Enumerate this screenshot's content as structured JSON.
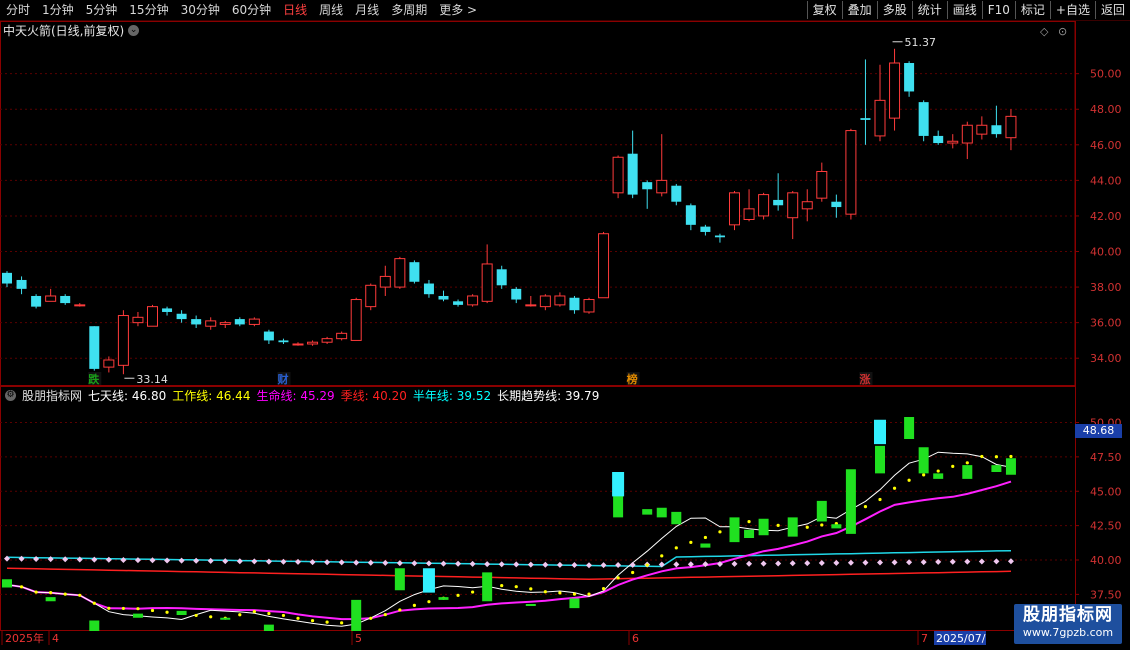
{
  "toolbar": {
    "periods": [
      "分时",
      "1分钟",
      "5分钟",
      "15分钟",
      "30分钟",
      "60分钟",
      "日线",
      "周线",
      "月线",
      "多周期",
      "更多 >"
    ],
    "active_period": "日线",
    "right_buttons": [
      "复权",
      "叠加",
      "多股",
      "统计",
      "画线",
      "F10",
      "标记",
      "+自选",
      "返回"
    ]
  },
  "main_chart": {
    "title": "中天火箭(日线,前复权)",
    "y_ticks": [
      "50.00",
      "48.00",
      "46.00",
      "44.00",
      "42.00",
      "40.00",
      "38.00",
      "36.00",
      "34.00"
    ],
    "high_label": "51.37",
    "low_label": "33.14",
    "event_tags": [
      {
        "text": "跌",
        "color": "#1aa01a"
      },
      {
        "text": "财",
        "color": "#2a60d0"
      },
      {
        "text": "榜",
        "color": "#e08a00"
      },
      {
        "text": "涨",
        "color": "#c83030"
      }
    ]
  },
  "indicator": {
    "name": "股朋指标网",
    "lines": [
      {
        "label": "七天线:",
        "value": "46.80",
        "color": "#ffffff"
      },
      {
        "label": "工作线:",
        "value": "46.44",
        "color": "#ffff00"
      },
      {
        "label": "生命线:",
        "value": "45.29",
        "color": "#ff00ff"
      },
      {
        "label": "季线:",
        "value": "40.20",
        "color": "#ff2020"
      },
      {
        "label": "半年线:",
        "value": "39.52",
        "color": "#00ffff"
      },
      {
        "label": "长期趋势线:",
        "value": "39.79",
        "color": "#ffffff"
      }
    ],
    "y_ticks": [
      "50.00",
      "47.50",
      "45.00",
      "42.50",
      "40.00",
      "37.50"
    ],
    "current_price": "48.68"
  },
  "date_axis": {
    "labels": [
      "2025年",
      "4",
      "5",
      "6",
      "7",
      "2025/07/"
    ]
  },
  "watermark": {
    "line1": "股朋指标网",
    "line2": "www.7gpzb.com"
  },
  "chart_data": {
    "type": "candlestick",
    "title": "中天火箭(日线,前复权)",
    "ylim": [
      33,
      51.5
    ],
    "candles": [
      {
        "o": 38.8,
        "c": 38.2,
        "h": 38.9,
        "l": 38.0
      },
      {
        "o": 38.4,
        "c": 37.9,
        "h": 38.6,
        "l": 37.6
      },
      {
        "o": 37.5,
        "c": 36.9,
        "h": 37.6,
        "l": 36.8
      },
      {
        "o": 37.2,
        "c": 37.5,
        "h": 37.9,
        "l": 37.2
      },
      {
        "o": 37.5,
        "c": 37.1,
        "h": 37.6,
        "l": 37.0
      },
      {
        "o": 37.0,
        "c": 37.0,
        "h": 37.1,
        "l": 36.9
      },
      {
        "o": 35.8,
        "c": 33.4,
        "h": 35.8,
        "l": 33.3
      },
      {
        "o": 33.5,
        "c": 33.9,
        "h": 34.1,
        "l": 33.2
      },
      {
        "o": 33.6,
        "c": 36.4,
        "h": 36.7,
        "l": 33.1
      },
      {
        "o": 36.0,
        "c": 36.3,
        "h": 36.6,
        "l": 35.8
      },
      {
        "o": 35.8,
        "c": 36.9,
        "h": 37.0,
        "l": 35.8
      },
      {
        "o": 36.8,
        "c": 36.6,
        "h": 36.9,
        "l": 36.4
      },
      {
        "o": 36.5,
        "c": 36.2,
        "h": 36.7,
        "l": 36.0
      },
      {
        "o": 36.2,
        "c": 35.9,
        "h": 36.4,
        "l": 35.7
      },
      {
        "o": 35.8,
        "c": 36.1,
        "h": 36.3,
        "l": 35.6
      },
      {
        "o": 35.9,
        "c": 36.0,
        "h": 36.1,
        "l": 35.7
      },
      {
        "o": 36.2,
        "c": 35.9,
        "h": 36.3,
        "l": 35.8
      },
      {
        "o": 35.9,
        "c": 36.2,
        "h": 36.3,
        "l": 35.8
      },
      {
        "o": 35.5,
        "c": 35.0,
        "h": 35.6,
        "l": 34.8
      },
      {
        "o": 35.0,
        "c": 34.9,
        "h": 35.1,
        "l": 34.8
      },
      {
        "o": 34.8,
        "c": 34.8,
        "h": 34.9,
        "l": 34.7
      },
      {
        "o": 34.8,
        "c": 34.9,
        "h": 35.0,
        "l": 34.7
      },
      {
        "o": 34.9,
        "c": 35.1,
        "h": 35.2,
        "l": 34.8
      },
      {
        "o": 35.1,
        "c": 35.4,
        "h": 35.5,
        "l": 35.0
      },
      {
        "o": 35.0,
        "c": 37.3,
        "h": 37.4,
        "l": 35.0
      },
      {
        "o": 36.9,
        "c": 38.1,
        "h": 38.2,
        "l": 36.7
      },
      {
        "o": 38.0,
        "c": 38.6,
        "h": 39.2,
        "l": 37.5
      },
      {
        "o": 38.0,
        "c": 39.6,
        "h": 39.7,
        "l": 37.9
      },
      {
        "o": 39.4,
        "c": 38.3,
        "h": 39.5,
        "l": 38.2
      },
      {
        "o": 38.2,
        "c": 37.6,
        "h": 38.4,
        "l": 37.4
      },
      {
        "o": 37.5,
        "c": 37.3,
        "h": 37.8,
        "l": 37.2
      },
      {
        "o": 37.2,
        "c": 37.0,
        "h": 37.3,
        "l": 36.9
      },
      {
        "o": 37.0,
        "c": 37.5,
        "h": 37.6,
        "l": 36.9
      },
      {
        "o": 37.2,
        "c": 39.3,
        "h": 40.4,
        "l": 37.1
      },
      {
        "o": 39.0,
        "c": 38.1,
        "h": 39.2,
        "l": 37.9
      },
      {
        "o": 37.9,
        "c": 37.3,
        "h": 38.0,
        "l": 37.1
      },
      {
        "o": 37.0,
        "c": 37.0,
        "h": 37.5,
        "l": 36.9
      },
      {
        "o": 36.9,
        "c": 37.5,
        "h": 37.6,
        "l": 36.7
      },
      {
        "o": 37.0,
        "c": 37.5,
        "h": 37.7,
        "l": 36.9
      },
      {
        "o": 37.4,
        "c": 36.7,
        "h": 37.5,
        "l": 36.5
      },
      {
        "o": 36.6,
        "c": 37.3,
        "h": 37.4,
        "l": 36.5
      },
      {
        "o": 37.4,
        "c": 41.0,
        "h": 41.1,
        "l": 37.4
      },
      {
        "o": 43.3,
        "c": 45.3,
        "h": 45.4,
        "l": 43.0
      },
      {
        "o": 45.5,
        "c": 43.2,
        "h": 46.8,
        "l": 43.0
      },
      {
        "o": 43.9,
        "c": 43.5,
        "h": 44.0,
        "l": 42.4
      },
      {
        "o": 43.3,
        "c": 44.0,
        "h": 46.6,
        "l": 43.1
      },
      {
        "o": 43.7,
        "c": 42.8,
        "h": 43.8,
        "l": 42.6
      },
      {
        "o": 42.6,
        "c": 41.5,
        "h": 42.7,
        "l": 41.2
      },
      {
        "o": 41.4,
        "c": 41.1,
        "h": 41.5,
        "l": 40.9
      },
      {
        "o": 40.9,
        "c": 40.8,
        "h": 41.0,
        "l": 40.5
      },
      {
        "o": 41.5,
        "c": 43.3,
        "h": 43.4,
        "l": 41.2
      },
      {
        "o": 41.8,
        "c": 42.4,
        "h": 43.5,
        "l": 41.7
      },
      {
        "o": 42.0,
        "c": 43.2,
        "h": 43.3,
        "l": 41.8
      },
      {
        "o": 42.9,
        "c": 42.6,
        "h": 44.4,
        "l": 42.3
      },
      {
        "o": 41.9,
        "c": 43.3,
        "h": 43.4,
        "l": 40.7
      },
      {
        "o": 42.4,
        "c": 42.8,
        "h": 43.5,
        "l": 41.7
      },
      {
        "o": 43.0,
        "c": 44.5,
        "h": 45.0,
        "l": 42.8
      },
      {
        "o": 42.8,
        "c": 42.5,
        "h": 43.2,
        "l": 41.9
      },
      {
        "o": 42.1,
        "c": 46.8,
        "h": 46.9,
        "l": 41.8
      },
      {
        "o": 47.5,
        "c": 47.4,
        "h": 50.8,
        "l": 46.0
      },
      {
        "o": 46.5,
        "c": 48.5,
        "h": 50.5,
        "l": 46.2
      },
      {
        "o": 47.5,
        "c": 50.6,
        "h": 51.4,
        "l": 46.8
      },
      {
        "o": 50.6,
        "c": 49.0,
        "h": 50.7,
        "l": 48.7
      },
      {
        "o": 48.4,
        "c": 46.5,
        "h": 48.5,
        "l": 46.2
      },
      {
        "o": 46.5,
        "c": 46.1,
        "h": 46.8,
        "l": 46.0
      },
      {
        "o": 46.1,
        "c": 46.2,
        "h": 46.6,
        "l": 45.8
      },
      {
        "o": 46.1,
        "c": 47.1,
        "h": 47.3,
        "l": 45.2
      },
      {
        "o": 46.6,
        "c": 47.1,
        "h": 47.6,
        "l": 46.3
      },
      {
        "o": 47.1,
        "c": 46.6,
        "h": 48.2,
        "l": 46.4
      },
      {
        "o": 46.4,
        "c": 47.6,
        "h": 48.0,
        "l": 45.7
      }
    ]
  }
}
